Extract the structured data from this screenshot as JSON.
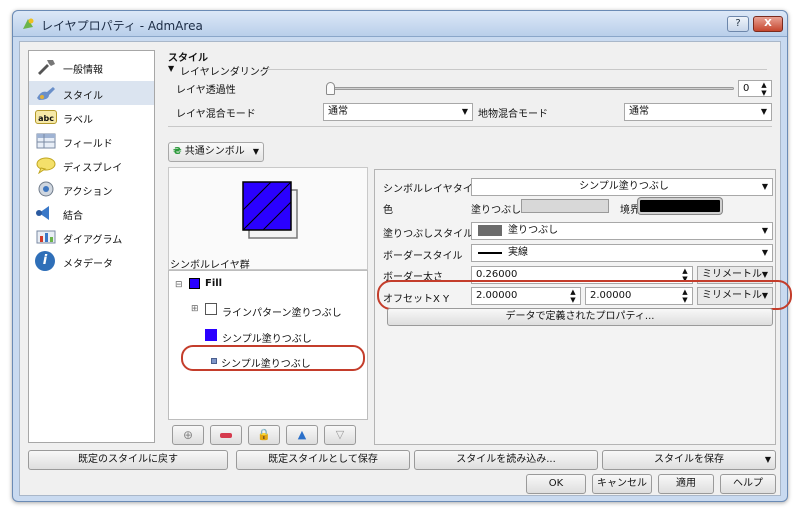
{
  "window": {
    "title": "レイヤプロパティ - AdmArea",
    "help_label": "?",
    "close_label": "X"
  },
  "sidebar": {
    "items": [
      {
        "label": "一般情報",
        "icon": "wrench-icon"
      },
      {
        "label": "スタイル",
        "icon": "paint-icon",
        "active": true
      },
      {
        "label": "ラベル",
        "icon": "label-abc-icon",
        "icon_text": "abc"
      },
      {
        "label": "フィールド",
        "icon": "table-icon"
      },
      {
        "label": "ディスプレイ",
        "icon": "speech-bubble-icon"
      },
      {
        "label": "アクション",
        "icon": "gear-action-icon"
      },
      {
        "label": "結合",
        "icon": "join-icon"
      },
      {
        "label": "ダイアグラム",
        "icon": "diagram-icon"
      },
      {
        "label": "メタデータ",
        "icon": "info-icon",
        "icon_text": "i"
      }
    ]
  },
  "style": {
    "section_title": "スタイル",
    "rendering_group": "レイヤレンダリング",
    "transparency_label": "レイヤ透過性",
    "transparency_value": "0",
    "blend_label": "レイヤ混合モード",
    "blend_value": "通常",
    "feature_blend_label": "地物混合モード",
    "feature_blend_value": "通常",
    "renderer_value": "共通シンボル"
  },
  "symbol_layers": {
    "label": "シンボルレイヤ群",
    "fill": "Fill",
    "line_pattern": "ラインパターン塗りつぶし",
    "simple_fill_1": "シンプル塗りつぶし",
    "simple_fill_2": "シンプル塗りつぶし"
  },
  "props": {
    "layer_type_label": "シンボルレイヤタイプ",
    "layer_type_value": "シンプル塗りつぶし",
    "color_label": "色",
    "fill_label": "塗りつぶし",
    "border_label": "境界線",
    "fill_style_label": "塗りつぶしスタイル",
    "fill_style_value": "塗りつぶし",
    "border_style_label": "ボーダースタイル",
    "border_style_value": "実線",
    "border_width_label": "ボーダー太さ",
    "border_width_value": "0.26000",
    "border_unit": "ミリメートル",
    "offset_label": "オフセットX Y",
    "offset_x": "2.00000",
    "offset_y": "2.00000",
    "offset_unit": "ミリメートル",
    "data_defined_button": "データで定義されたプロパティ..."
  },
  "footer": {
    "restore_default": "既定のスタイルに戻す",
    "save_default": "既定スタイルとして保存",
    "load_style": "スタイルを読み込み...",
    "save_style": "スタイルを保存",
    "ok": "OK",
    "cancel": "キャンセル",
    "apply": "適用",
    "help": "ヘルプ"
  },
  "colors": {
    "fill_swatch": "#2a00ff",
    "highlight_oval": "#c43d2b",
    "sidebar_active": "#dbe4f0"
  }
}
